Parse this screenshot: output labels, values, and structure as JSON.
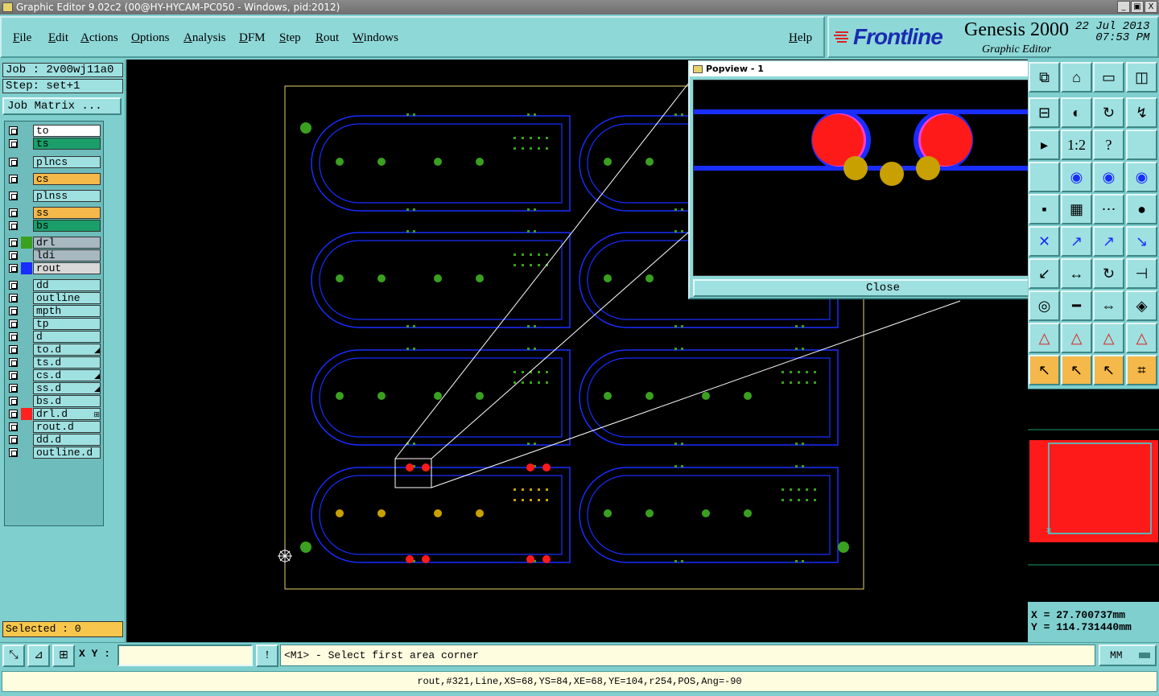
{
  "window": {
    "title": "Graphic Editor 9.02c2 (00@HY-HYCAM-PC050 - Windows, pid:2012)",
    "buttons": [
      "_",
      "▣",
      "X"
    ]
  },
  "menu": {
    "items": [
      "File",
      "Edit",
      "Actions",
      "Options",
      "Analysis",
      "DFM",
      "Step",
      "Rout",
      "Windows"
    ],
    "help": "Help"
  },
  "brand": {
    "logo": "Frontline",
    "product": "Genesis 2000",
    "subtitle": "Graphic Editor",
    "date": "22 Jul 2013",
    "time": "07:53 PM"
  },
  "job": {
    "job_label": "Job : 2v00wj11a0",
    "step_label": "Step: set+1",
    "matrix_button": "Job Matrix ..."
  },
  "layers": [
    {
      "name": "to",
      "color": "#ffffff",
      "swatch": ""
    },
    {
      "name": "ts",
      "color": "#1a9e6a",
      "swatch": ""
    },
    {
      "name": "plncs",
      "color": "#9fe0e0",
      "swatch": ""
    },
    {
      "name": "cs",
      "color": "#f5b84a",
      "swatch": ""
    },
    {
      "name": "plnss",
      "color": "#9fe0e0",
      "swatch": ""
    },
    {
      "name": "ss",
      "color": "#f5b84a",
      "swatch": ""
    },
    {
      "name": "bs",
      "color": "#1a9e6a",
      "swatch": ""
    },
    {
      "name": "drl",
      "color": "#a8b8c0",
      "swatch": "#3aa020"
    },
    {
      "name": "ldi",
      "color": "#a8b8c0",
      "swatch": ""
    },
    {
      "name": "rout",
      "color": "#d8d8d8",
      "swatch": "#1a2dff"
    },
    {
      "name": "dd",
      "color": "#9fe0e0",
      "swatch": ""
    },
    {
      "name": "outline",
      "color": "#9fe0e0",
      "swatch": ""
    },
    {
      "name": "mpth",
      "color": "#9fe0e0",
      "swatch": ""
    },
    {
      "name": "tp",
      "color": "#9fe0e0",
      "swatch": ""
    },
    {
      "name": "d",
      "color": "#9fe0e0",
      "swatch": ""
    },
    {
      "name": "to.d",
      "color": "#9fe0e0",
      "swatch": "",
      "mark": "◢"
    },
    {
      "name": "ts.d",
      "color": "#9fe0e0",
      "swatch": ""
    },
    {
      "name": "cs.d",
      "color": "#9fe0e0",
      "swatch": "",
      "mark": "◢"
    },
    {
      "name": "ss.d",
      "color": "#9fe0e0",
      "swatch": "",
      "mark": "◢"
    },
    {
      "name": "bs.d",
      "color": "#9fe0e0",
      "swatch": ""
    },
    {
      "name": "drl.d",
      "color": "#9fe0e0",
      "swatch": "#ff2020",
      "mark": "⊞"
    },
    {
      "name": "rout.d",
      "color": "#9fe0e0",
      "swatch": ""
    },
    {
      "name": "dd.d",
      "color": "#9fe0e0",
      "swatch": ""
    },
    {
      "name": "outline.d",
      "color": "#9fe0e0",
      "swatch": ""
    }
  ],
  "selected": "Selected : 0",
  "popview": {
    "title": "Popview - 1",
    "close": "Close"
  },
  "coords": {
    "x": "X = 27.700737mm",
    "y": "Y = 114.731440mm"
  },
  "bottom": {
    "xy_label": "X Y :",
    "xy_value": "",
    "prompt": "<M1> - Select first area corner",
    "units": "MM"
  },
  "status": "rout,#321,Line,XS=68,YS=84,XE=68,YE=104,r254,POS,Ang=-90",
  "colors": {
    "rout": "#1a2dff",
    "drill": "#3aa020",
    "pad_selected": "#ff1a1a",
    "pad_gold": "#c8a000",
    "profile": "#e8d36a"
  }
}
